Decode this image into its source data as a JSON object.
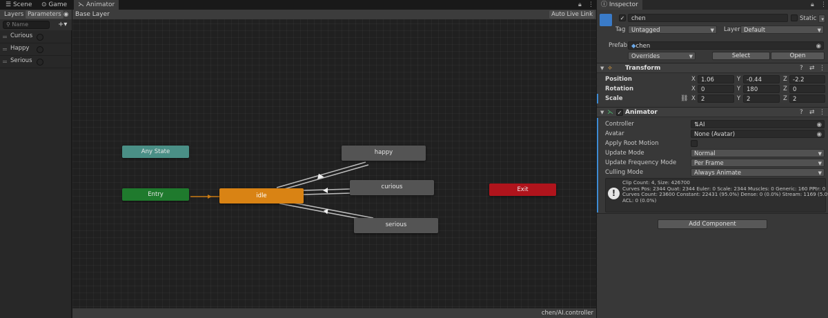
{
  "tabs": [
    {
      "label": "Scene",
      "icon": "scene-icon"
    },
    {
      "label": "Game",
      "icon": "gamepad-icon"
    },
    {
      "label": "Animator",
      "icon": "animator-icon",
      "active": true
    }
  ],
  "left_panel": {
    "tabs": [
      "Layers",
      "Parameters"
    ],
    "active_tab": "Parameters",
    "search_placeholder": "Name",
    "add_label": "+▾",
    "parameters": [
      {
        "name": "Curious"
      },
      {
        "name": "Happy"
      },
      {
        "name": "Serious"
      }
    ]
  },
  "graph": {
    "breadcrumb": "Base Layer",
    "auto_live_link": "Auto Live Link",
    "footer_path": "chen/AI.controller",
    "states": {
      "any_state": "Any State",
      "entry": "Entry",
      "idle": "idle",
      "happy": "happy",
      "curious": "curious",
      "serious": "serious",
      "exit": "Exit"
    }
  },
  "inspector": {
    "tab_label": "Inspector",
    "object_name": "chen",
    "static_label": "Static",
    "tag_label": "Tag",
    "tag_value": "Untagged",
    "layer_label": "Layer",
    "layer_value": "Default",
    "prefab_label": "Prefab",
    "prefab_value": "chen",
    "overrides_label": "Overrides",
    "select_label": "Select",
    "open_label": "Open",
    "transform": {
      "title": "Transform",
      "position": {
        "label": "Position",
        "x": "1.06",
        "y": "-0.44",
        "z": "-2.2"
      },
      "rotation": {
        "label": "Rotation",
        "x": "0",
        "y": "180",
        "z": "0"
      },
      "scale": {
        "label": "Scale",
        "x": "2",
        "y": "2",
        "z": "2"
      }
    },
    "axis_labels": {
      "x": "X",
      "y": "Y",
      "z": "Z"
    },
    "animator": {
      "title": "Animator",
      "controller_label": "Controller",
      "controller_value": "AI",
      "avatar_label": "Avatar",
      "avatar_value": "None (Avatar)",
      "apply_root_motion_label": "Apply Root Motion",
      "update_mode_label": "Update Mode",
      "update_mode_value": "Normal",
      "update_frequency_label": "Update Frequency Mode",
      "update_frequency_value": "Per Frame",
      "culling_mode_label": "Culling Mode",
      "culling_mode_value": "Always Animate",
      "info_lines": [
        "Clip Count: 4, Size: 426700",
        "Curves Pos: 2344 Quat: 2344 Euler: 0 Scale: 2344 Muscles: 0 Generic: 160 PPtr: 0",
        "Curves Count: 23600 Constant: 22431 (95.0%) Dense: 0 (0.0%) Stream: 1169 (5.0%)",
        "ACL: 0 (0.0%)"
      ]
    },
    "add_component_label": "Add Component"
  },
  "colors": {
    "entry": "#1f7a2d",
    "idle": "#d98314",
    "exit": "#b0141c",
    "any_state": "#4a8f86",
    "state": "#545454"
  }
}
